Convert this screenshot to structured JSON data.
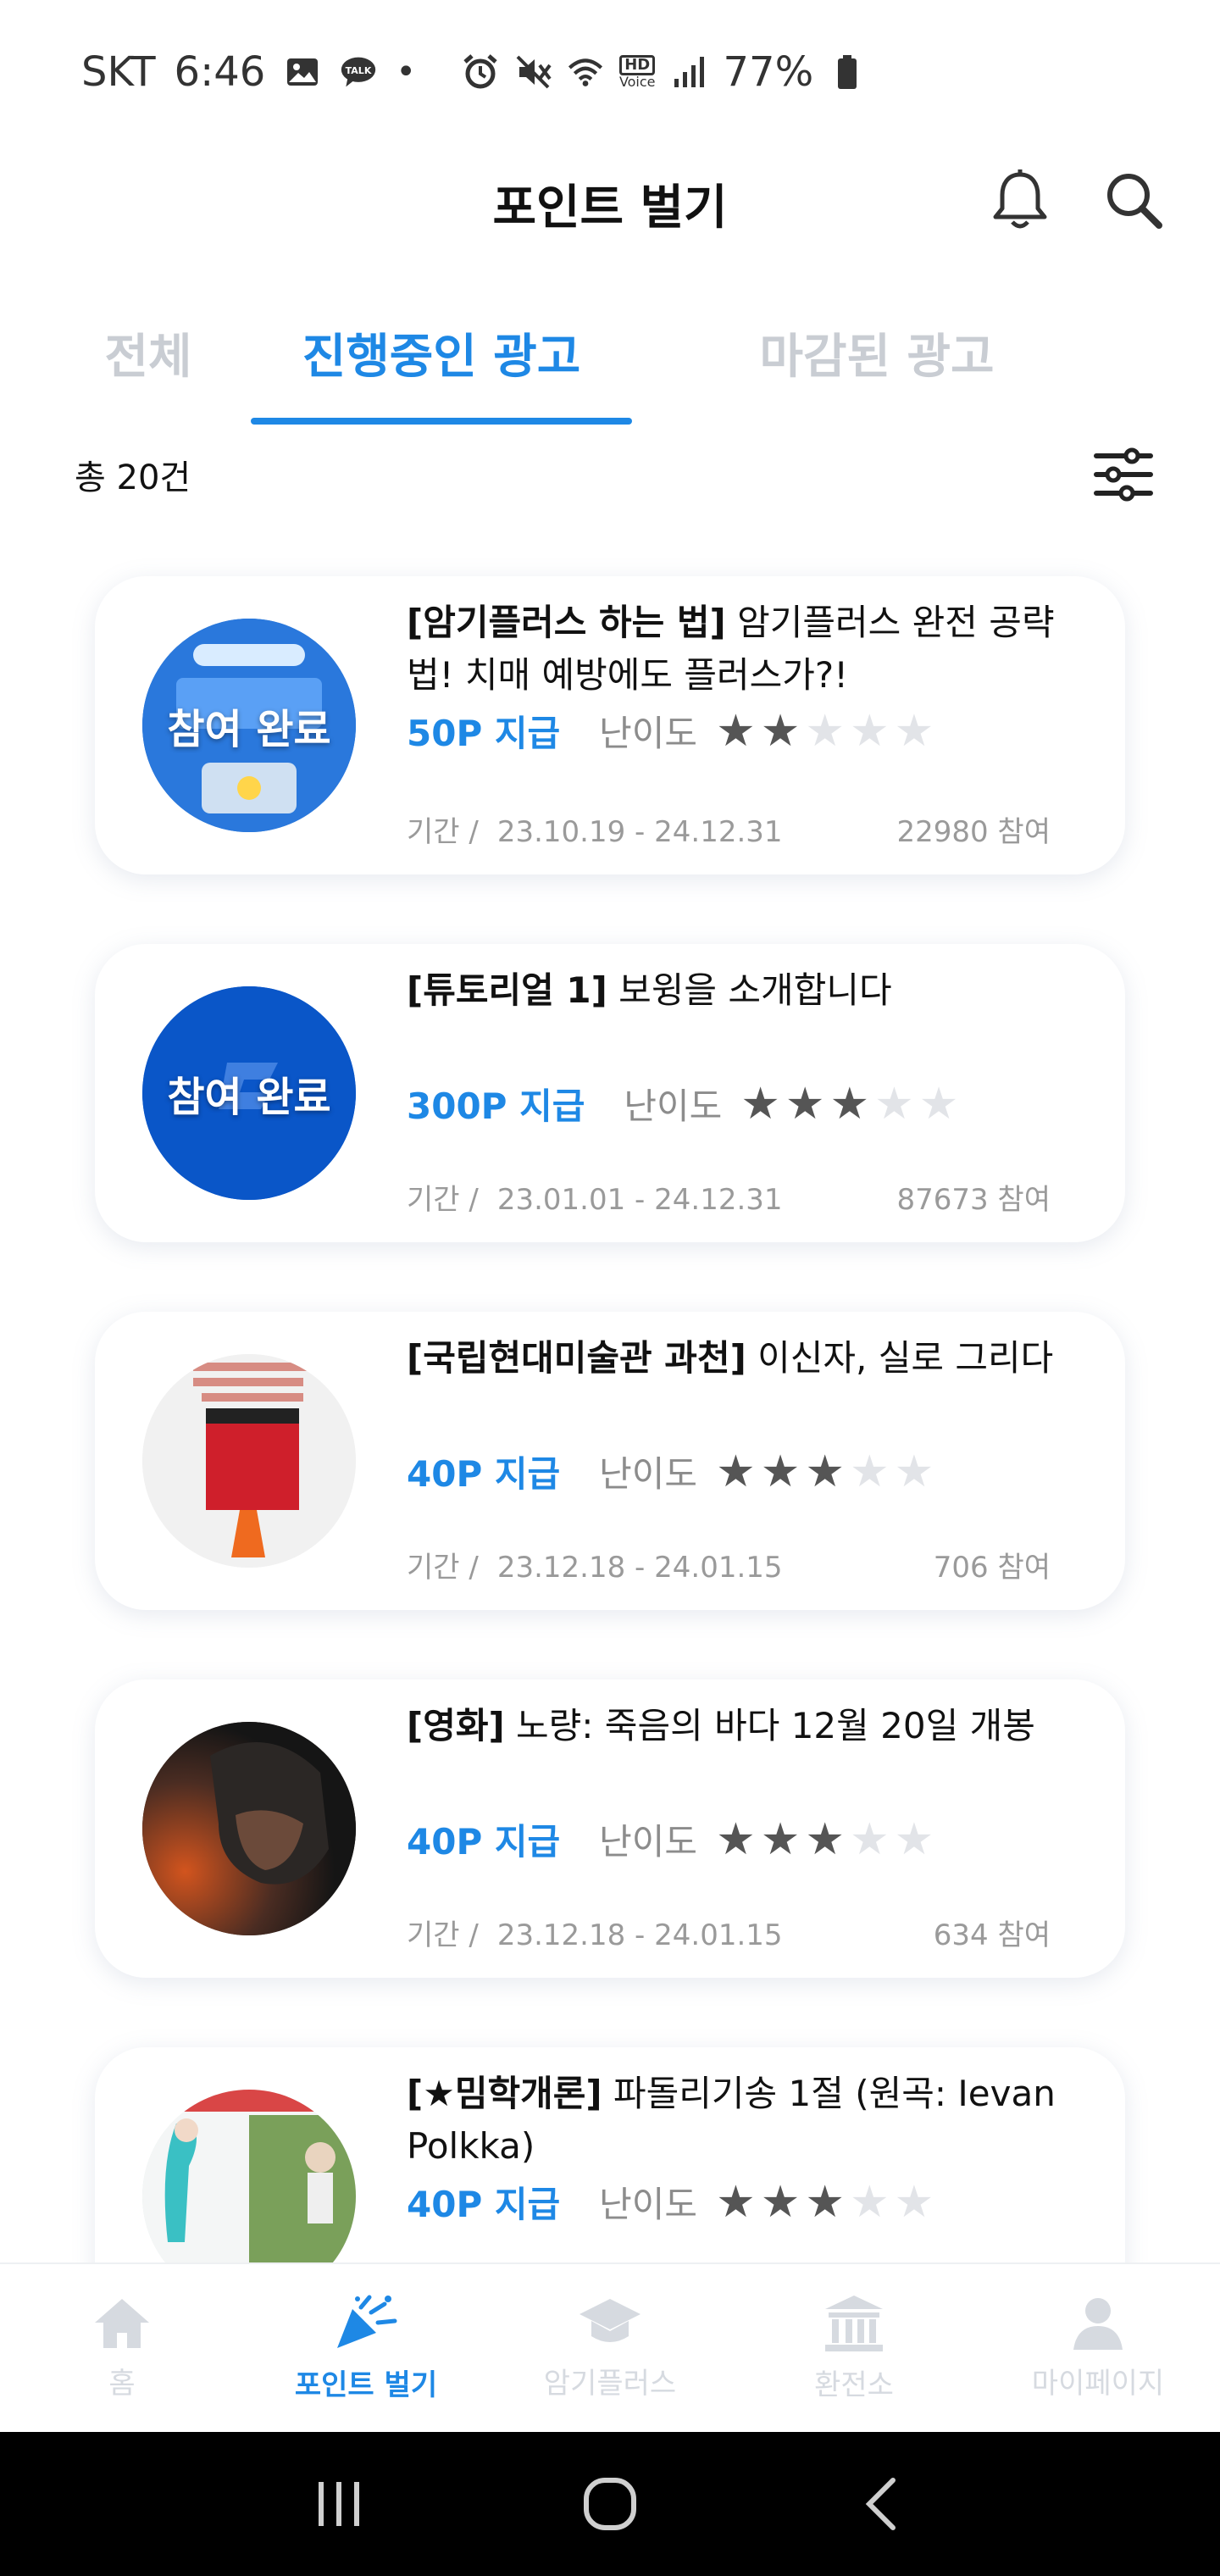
{
  "status_bar": {
    "carrier": "SKT",
    "time": "6:46",
    "talk_badge": "TALK",
    "dot": "•",
    "hd_label": "HD",
    "voice_label": "Voice",
    "battery": "77%"
  },
  "header": {
    "title": "포인트 벌기"
  },
  "tabs": [
    {
      "label": "전체",
      "active": false
    },
    {
      "label": "진행중인 광고",
      "active": true
    },
    {
      "label": "마감된 광고",
      "active": false
    }
  ],
  "summary": {
    "total_label": "총 20건"
  },
  "ads": [
    {
      "bracket": "[암기플러스 하는 법]",
      "title": " 암기플러스 완전 공략법! 치매 예방에도 플러스가?!",
      "reward": "50P 지급",
      "difficulty_label": "난이도",
      "difficulty": 2,
      "period_label": "기간 /",
      "period": "23.10.19 - 24.12.31",
      "participants": "22980 참여",
      "badge": "참여 완료",
      "thumb_bg": "#1f6fd1"
    },
    {
      "bracket": "[튜토리얼 1]",
      "title": " 보윙을 소개합니다",
      "reward": "300P 지급",
      "difficulty_label": "난이도",
      "difficulty": 3,
      "period_label": "기간 /",
      "period": "23.01.01 - 24.12.31",
      "participants": "87673 참여",
      "badge": "참여 완료",
      "thumb_bg": "#0a56c8"
    },
    {
      "bracket": "[국립현대미술관 과천]",
      "title": " 이신자, 실로 그리다",
      "reward": "40P 지급",
      "difficulty_label": "난이도",
      "difficulty": 3,
      "period_label": "기간 /",
      "period": "23.12.18 - 24.01.15",
      "participants": "706 참여",
      "badge": "",
      "thumb_bg": "#f3f3f3"
    },
    {
      "bracket": "[영화]",
      "title": " 노량: 죽음의 바다 12월 20일 개봉",
      "reward": "40P 지급",
      "difficulty_label": "난이도",
      "difficulty": 3,
      "period_label": "기간 /",
      "period": "23.12.18 - 24.01.15",
      "participants": "634 참여",
      "badge": "",
      "thumb_bg": "#3a2a22"
    },
    {
      "bracket": "[★밈학개론]",
      "title": " 파돌리기송 1절 (원곡: Ievan Polkka)",
      "reward": "40P 지급",
      "difficulty_label": "난이도",
      "difficulty": 3,
      "period_label": "",
      "period": "",
      "participants": "",
      "badge": "",
      "thumb_bg": "#dfe9e6"
    }
  ],
  "bottom_nav": [
    {
      "label": "홈",
      "icon": "home-icon",
      "active": false
    },
    {
      "label": "포인트 벌기",
      "icon": "party-popper-icon",
      "active": true
    },
    {
      "label": "암기플러스",
      "icon": "graduation-cap-icon",
      "active": false
    },
    {
      "label": "환전소",
      "icon": "bank-icon",
      "active": false
    },
    {
      "label": "마이페이지",
      "icon": "person-icon",
      "active": false
    }
  ],
  "colors": {
    "accent": "#1e88e5",
    "inactive_tab": "#c9cdd3",
    "star_on": "#555555",
    "star_off": "#e2e4e8"
  }
}
